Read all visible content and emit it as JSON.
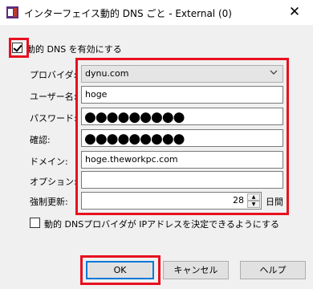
{
  "window": {
    "title": "インターフェイス動的 DNS ごと - External (0)",
    "close_glyph": "✕"
  },
  "enable_dynamic_dns": {
    "label": "動的 DNS を有効にする",
    "checked": true
  },
  "form": {
    "provider": {
      "label": "プロバイダ:",
      "value": "dynu.com"
    },
    "username": {
      "label": "ユーザー名:",
      "value": "hoge"
    },
    "password": {
      "label": "パスワード:",
      "value": "●●●●●●●●●"
    },
    "confirm": {
      "label": "確認:",
      "value": "●●●●●●●●●"
    },
    "domain": {
      "label": "ドメイン:",
      "value": "hoge.theworkpc.com"
    },
    "options": {
      "label": "オプション:",
      "value": ""
    },
    "force_update": {
      "label": "強制更新:",
      "value": "28",
      "unit": "日間"
    }
  },
  "provider_determines_ip": {
    "label": "動的 DNSプロバイダが IPアドレスを決定できるようにする",
    "checked": false
  },
  "buttons": {
    "ok": "OK",
    "cancel": "キャンセル",
    "help": "ヘルプ"
  },
  "colors": {
    "highlight": "#e8101f",
    "focus_blue": "#0078d7"
  },
  "icons": {
    "app": "app-icon",
    "close": "close-icon",
    "dropdown": "chevron-down-icon"
  }
}
